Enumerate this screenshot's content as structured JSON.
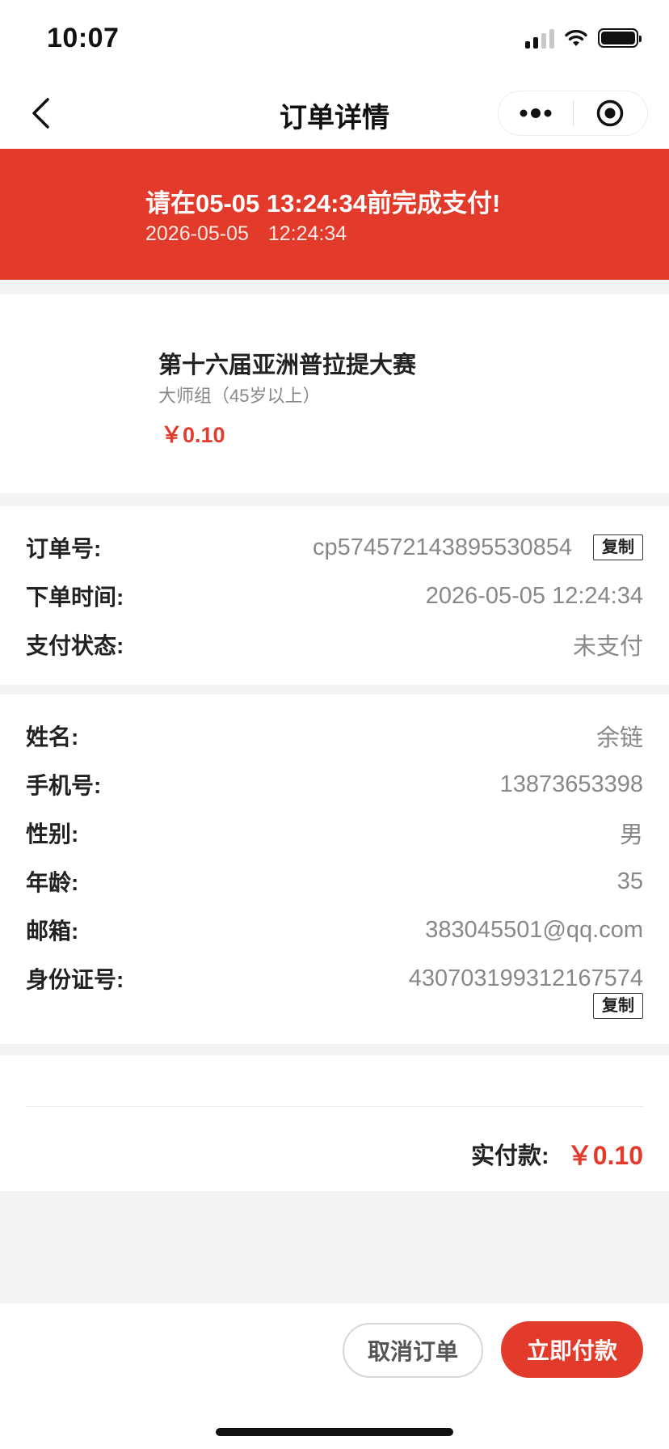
{
  "status_bar": {
    "time": "10:07"
  },
  "nav": {
    "title": "订单详情"
  },
  "banner": {
    "prefix": "请在",
    "deadline": "05-05 13:24:34",
    "suffix": "前完成支付!",
    "date": "2026-05-05",
    "time": "12:24:34"
  },
  "product": {
    "title": "第十六届亚洲普拉提大赛",
    "subtitle": "大师组（45岁以上）",
    "price": "￥0.10"
  },
  "order": {
    "number_label": "订单号:",
    "number_value": "cp574572143895530854",
    "copy_label": "复制",
    "time_label": "下单时间:",
    "time_value": "2026-05-05 12:24:34",
    "status_label": "支付状态:",
    "status_value": "未支付"
  },
  "person": {
    "name_label": "姓名:",
    "name_value": "余链",
    "phone_label": "手机号:",
    "phone_value": "13873653398",
    "gender_label": "性别:",
    "gender_value": "男",
    "age_label": "年龄:",
    "age_value": "35",
    "email_label": "邮箱:",
    "email_value": "383045501@qq.com",
    "id_label": "身份证号:",
    "id_value": "430703199312167574",
    "copy_label": "复制"
  },
  "total": {
    "label": "实付款:",
    "value": "￥0.10"
  },
  "actions": {
    "cancel_label": "取消订单",
    "pay_label": "立即付款"
  },
  "colors": {
    "accent": "#e33b2b",
    "text": "#222222",
    "muted": "#888888",
    "background": "#f3f3f3"
  }
}
